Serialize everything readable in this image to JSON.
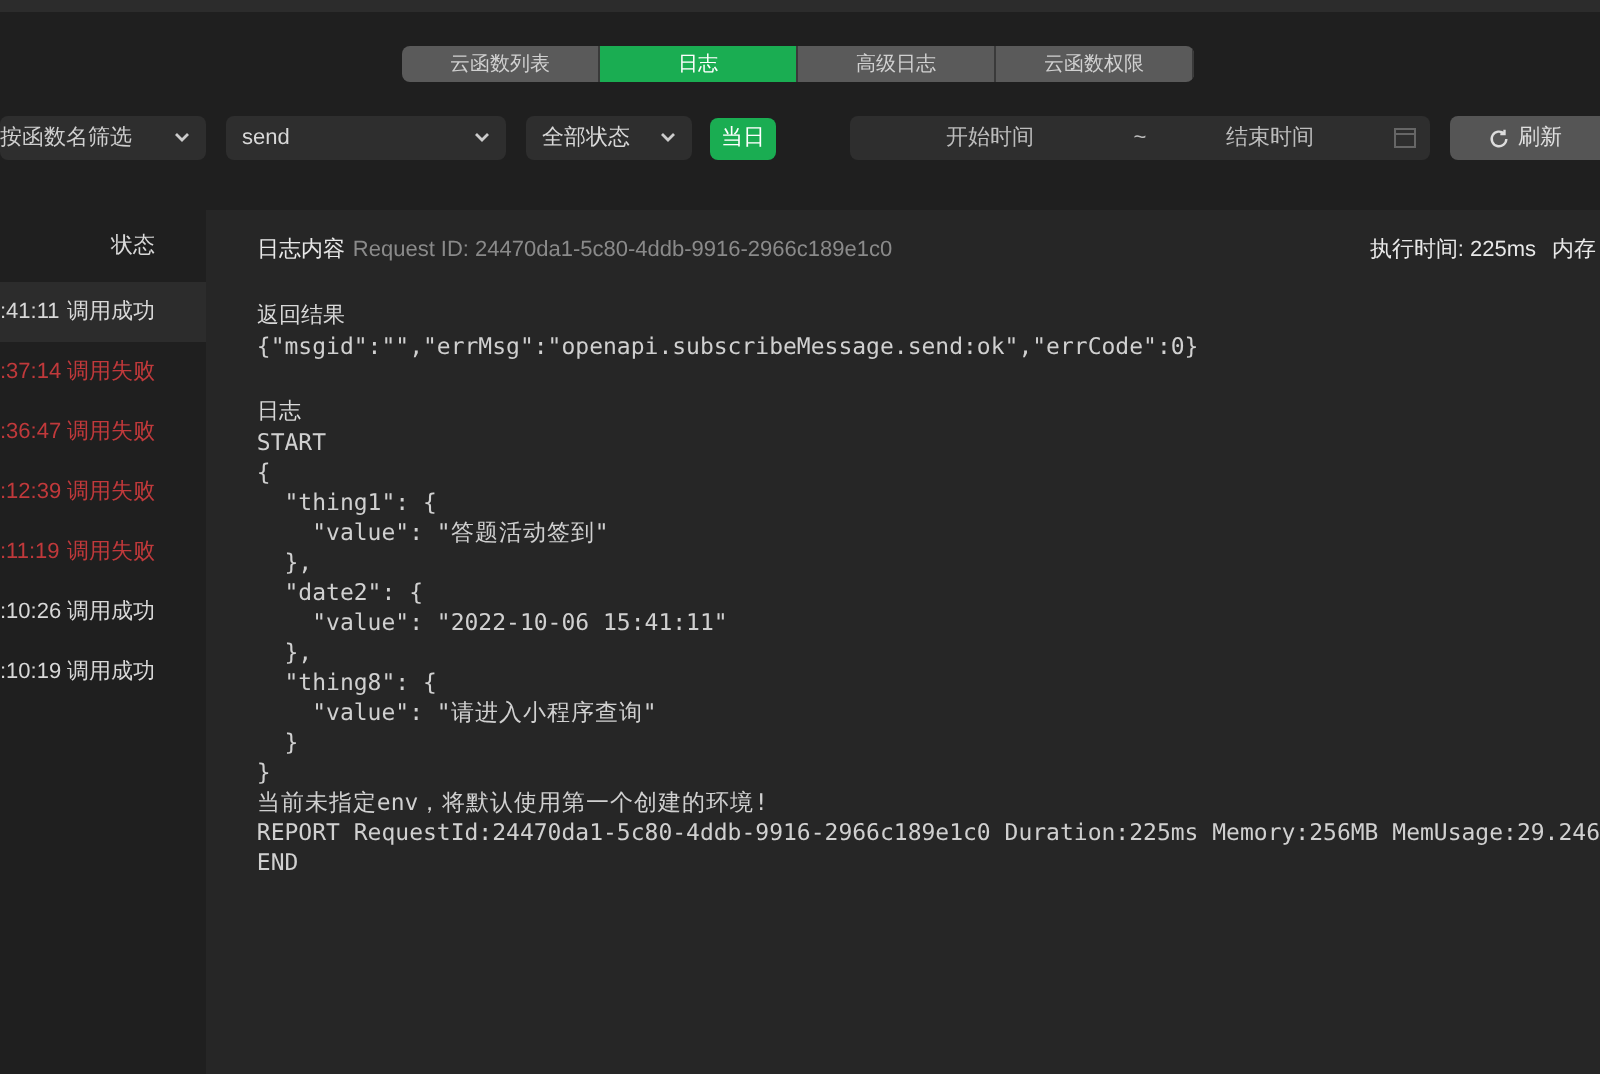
{
  "tabs": [
    {
      "label": "云函数列表",
      "selected": false
    },
    {
      "label": "日志",
      "selected": true
    },
    {
      "label": "高级日志",
      "selected": false
    },
    {
      "label": "云函数权限",
      "selected": false
    }
  ],
  "filters": {
    "function_filter": {
      "placeholder": "按函数名筛选"
    },
    "function_name": {
      "value": "send"
    },
    "status_filter": {
      "value": "全部状态"
    },
    "today_button": "当日",
    "start_time": {
      "placeholder": "开始时间"
    },
    "range_separator": "~",
    "end_time": {
      "placeholder": "结束时间"
    },
    "refresh_button": "刷新"
  },
  "log_list": {
    "status_header": "状态",
    "rows": [
      {
        "time": ":41:11",
        "status": "调用成功",
        "failed": false,
        "selected": true
      },
      {
        "time": ":37:14",
        "status": "调用失败",
        "failed": true,
        "selected": false
      },
      {
        "time": ":36:47",
        "status": "调用失败",
        "failed": true,
        "selected": false
      },
      {
        "time": ":12:39",
        "status": "调用失败",
        "failed": true,
        "selected": false
      },
      {
        "time": ":11:19",
        "status": "调用失败",
        "failed": true,
        "selected": false
      },
      {
        "time": ":10:26",
        "status": "调用成功",
        "failed": false,
        "selected": false
      },
      {
        "time": ":10:19",
        "status": "调用成功",
        "failed": false,
        "selected": false
      }
    ]
  },
  "detail": {
    "title": "日志内容",
    "request_id": "Request ID: 24470da1-5c80-4ddb-9916-2966c189e1c0",
    "exec_time": "执行时间: 225ms",
    "memory": "内存",
    "result_label": "返回结果",
    "result": "{\"msgid\":\"\",\"errMsg\":\"openapi.subscribeMessage.send:ok\",\"errCode\":0}",
    "log_label": "日志",
    "log_lines": [
      "START",
      "{",
      "  \"thing1\": {",
      "    \"value\": \"答题活动签到\"",
      "  },",
      "  \"date2\": {",
      "    \"value\": \"2022-10-06 15:41:11\"",
      "  },",
      "  \"thing8\": {",
      "    \"value\": \"请进入小程序查询\"",
      "  }",
      "}",
      "当前未指定env，将默认使用第一个创建的环境!",
      "REPORT RequestId:24470da1-5c80-4ddb-9916-2966c189e1c0 Duration:225ms Memory:256MB MemUsage:29.246",
      "END"
    ]
  }
}
